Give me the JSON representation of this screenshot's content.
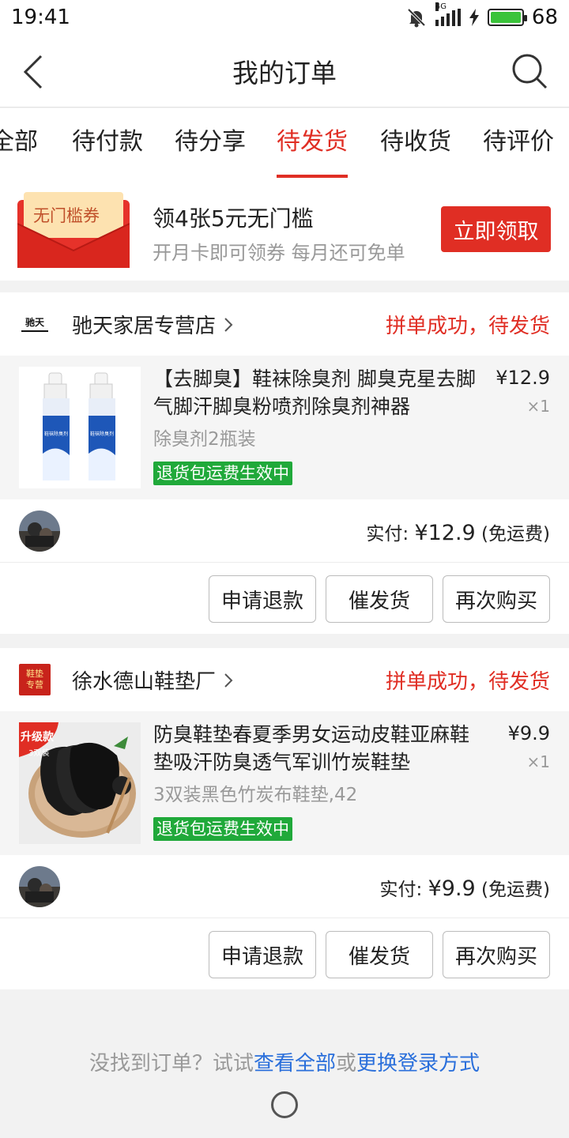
{
  "status_bar": {
    "time": "19:41",
    "network": "4G",
    "battery": "68"
  },
  "header": {
    "title": "我的订单"
  },
  "tabs": [
    {
      "label": "全部"
    },
    {
      "label": "待付款"
    },
    {
      "label": "待分享"
    },
    {
      "label": "待发货",
      "active": true
    },
    {
      "label": "待收货"
    },
    {
      "label": "待评价"
    }
  ],
  "promo": {
    "coupon_label": "无门槛券",
    "main": "领4张5元无门槛",
    "sub": "开月卡即可领券 每月还可免单",
    "button": "立即领取"
  },
  "orders": [
    {
      "shop_logo_text": "驰天",
      "shop_name": "驰天家居专营店",
      "status": "拼单成功，待发货",
      "title": "【去脚臭】鞋袜除臭剂 脚臭克星去脚气脚汗脚臭粉喷剂除臭剂神器",
      "spec": "除臭剂2瓶装",
      "price": "¥12.9",
      "qty": "×1",
      "badge": "退货包运费生效中",
      "paid_label": "实付:",
      "paid_amount": "¥12.9",
      "shipping": "(免运费)",
      "product_label": "鞋袜除臭剂",
      "buttons": [
        "申请退款",
        "催发货",
        "再次购买"
      ]
    },
    {
      "shop_logo_text": "鞋垫专营",
      "shop_name": "徐水德山鞋垫厂",
      "status": "拼单成功，待发货",
      "title": "防臭鞋垫春夏季男女运动皮鞋亚麻鞋垫吸汗防臭透气军训竹炭鞋垫",
      "spec": "3双装黑色竹炭布鞋垫,42",
      "price": "¥9.9",
      "qty": "×1",
      "badge": "退货包运费生效中",
      "paid_label": "实付:",
      "paid_amount": "¥9.9",
      "shipping": "(免运费)",
      "upgrade_badge": "升级款",
      "upgrade_sub": "3双装",
      "buttons": [
        "申请退款",
        "催发货",
        "再次购买"
      ]
    }
  ],
  "footer": {
    "prefix": "没找到订单？试试",
    "link1": "查看全部",
    "middle": "或",
    "link2": "更换登录方式"
  }
}
